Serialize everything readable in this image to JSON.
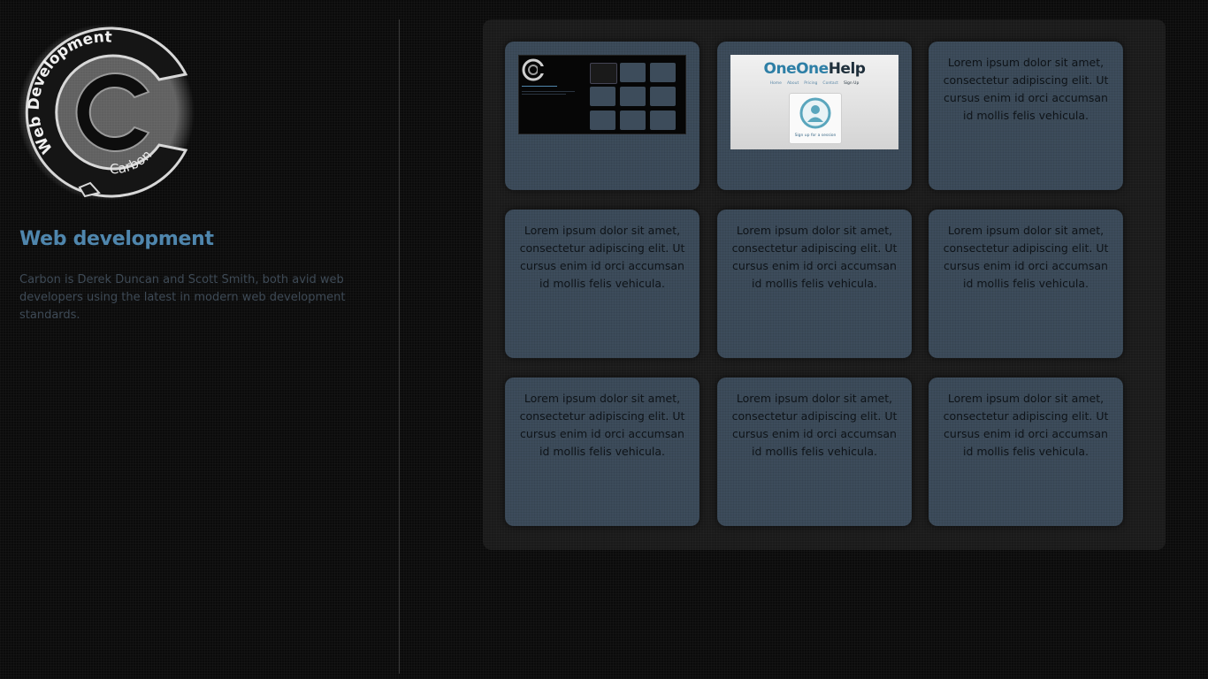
{
  "sidebar": {
    "logo": {
      "ring_text": "Web Development",
      "inner_text": "Carbon"
    },
    "heading": "Web development",
    "description": "Carbon is Derek Duncan and Scott Smith, both avid web developers using the latest in modern web development standards."
  },
  "portfolio": {
    "tiles": [
      {
        "kind": "thumb-dark"
      },
      {
        "kind": "thumb-light",
        "site_logo_a": "One",
        "site_logo_b": "One",
        "site_logo_c": "Help",
        "nav": [
          "Home",
          "About",
          "Pricing",
          "Contact",
          "Sign Up"
        ],
        "cta": "Sign up for a session"
      },
      {
        "kind": "text",
        "text": "Lorem ipsum dolor sit amet, consectetur adipiscing elit. Ut cursus enim id orci accumsan id mollis felis vehicula."
      },
      {
        "kind": "text",
        "text": "Lorem ipsum dolor sit amet, consectetur adipiscing elit. Ut cursus enim id orci accumsan id mollis felis vehicula."
      },
      {
        "kind": "text",
        "text": "Lorem ipsum dolor sit amet, consectetur adipiscing elit. Ut cursus enim id orci accumsan id mollis felis vehicula."
      },
      {
        "kind": "text",
        "text": "Lorem ipsum dolor sit amet, consectetur adipiscing elit. Ut cursus enim id orci accumsan id mollis felis vehicula."
      },
      {
        "kind": "text",
        "text": "Lorem ipsum dolor sit amet, consectetur adipiscing elit. Ut cursus enim id orci accumsan id mollis felis vehicula."
      },
      {
        "kind": "text",
        "text": "Lorem ipsum dolor sit amet, consectetur adipiscing elit. Ut cursus enim id orci accumsan id mollis felis vehicula."
      },
      {
        "kind": "text",
        "text": "Lorem ipsum dolor sit amet, consectetur adipiscing elit. Ut cursus enim id orci accumsan id mollis felis vehicula."
      }
    ]
  },
  "colors": {
    "background": "#0b0b0b",
    "accent": "#4f86ad",
    "tile": "#3d4c5b",
    "panel": "#1a1a1a"
  }
}
